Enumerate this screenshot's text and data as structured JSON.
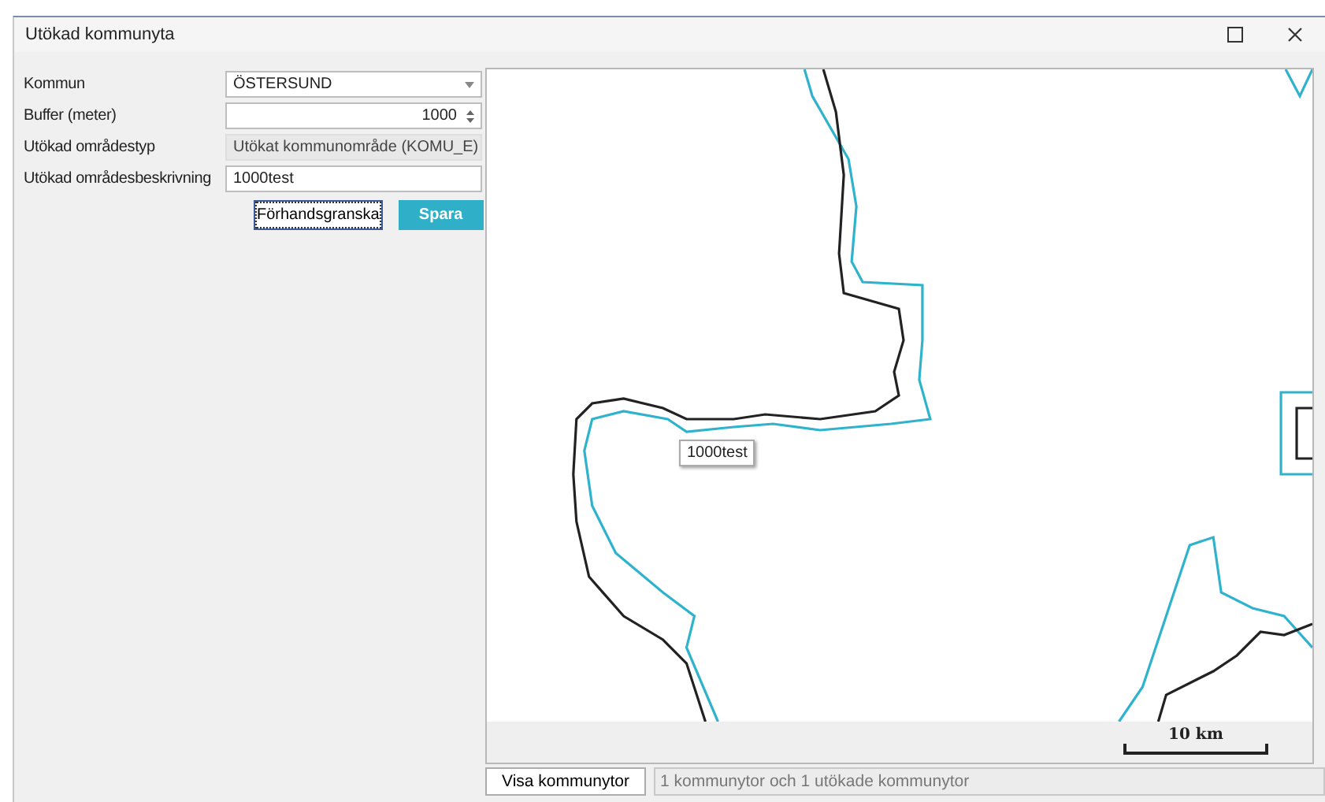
{
  "window": {
    "title": "Utökad kommunyta"
  },
  "form": {
    "fields": [
      {
        "label": "Kommun",
        "kind": "dropdown",
        "value": "ÖSTERSUND"
      },
      {
        "label": "Buffer (meter)",
        "kind": "spinner",
        "value": "1000"
      },
      {
        "label": "Utökad områdestyp",
        "kind": "readonly",
        "value": "Utökat kommunområde (KOMU_E)"
      },
      {
        "label": "Utökad områdesbeskrivning",
        "kind": "text",
        "value": "1000test"
      }
    ],
    "buttons": [
      {
        "label": "Förhandsgranska",
        "kind": "default",
        "focused": true
      },
      {
        "label": "Spara",
        "kind": "primary",
        "focused": false
      }
    ]
  },
  "map": {
    "feature_label": "1000test",
    "scale_label": "10 km"
  },
  "footer": {
    "button": "Visa kommunytor",
    "status": "1 kommunytor och 1 utökade kommunytor"
  }
}
